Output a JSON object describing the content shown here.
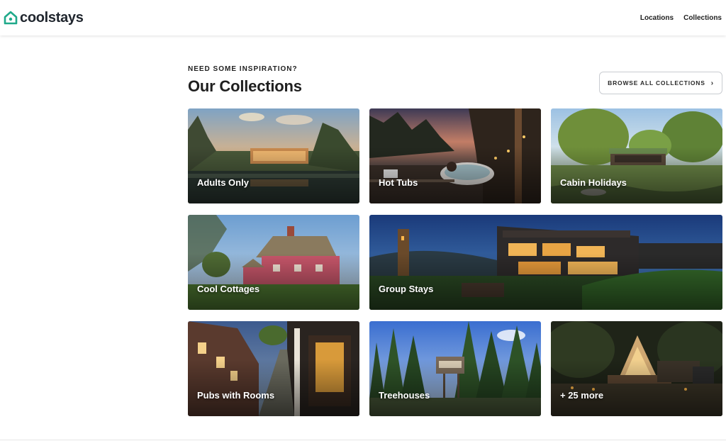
{
  "header": {
    "logo_text": "coolstays",
    "nav": [
      {
        "label": "Locations"
      },
      {
        "label": "Collections"
      }
    ],
    "brand_color": "#1fa98a"
  },
  "section": {
    "eyebrow": "NEED SOME INSPIRATION?",
    "title": "Our Collections",
    "browse_button": "BROWSE ALL COLLECTIONS"
  },
  "collections": [
    {
      "label": "Adults Only",
      "scene": "lake-cabin-sunset"
    },
    {
      "label": "Hot Tubs",
      "scene": "hot-tub-deck-dusk"
    },
    {
      "label": "Cabin Holidays",
      "scene": "forest-cabin-meadow"
    },
    {
      "label": "Cool Cottages",
      "scene": "pink-thatched-cottage"
    },
    {
      "label": "Group Stays",
      "scene": "modern-lodge-night"
    },
    {
      "label": "Pubs with Rooms",
      "scene": "old-street-pub"
    },
    {
      "label": "Treehouses",
      "scene": "forest-treehouse"
    },
    {
      "label": "+ 25 more",
      "scene": "glamping-tent-night"
    }
  ]
}
